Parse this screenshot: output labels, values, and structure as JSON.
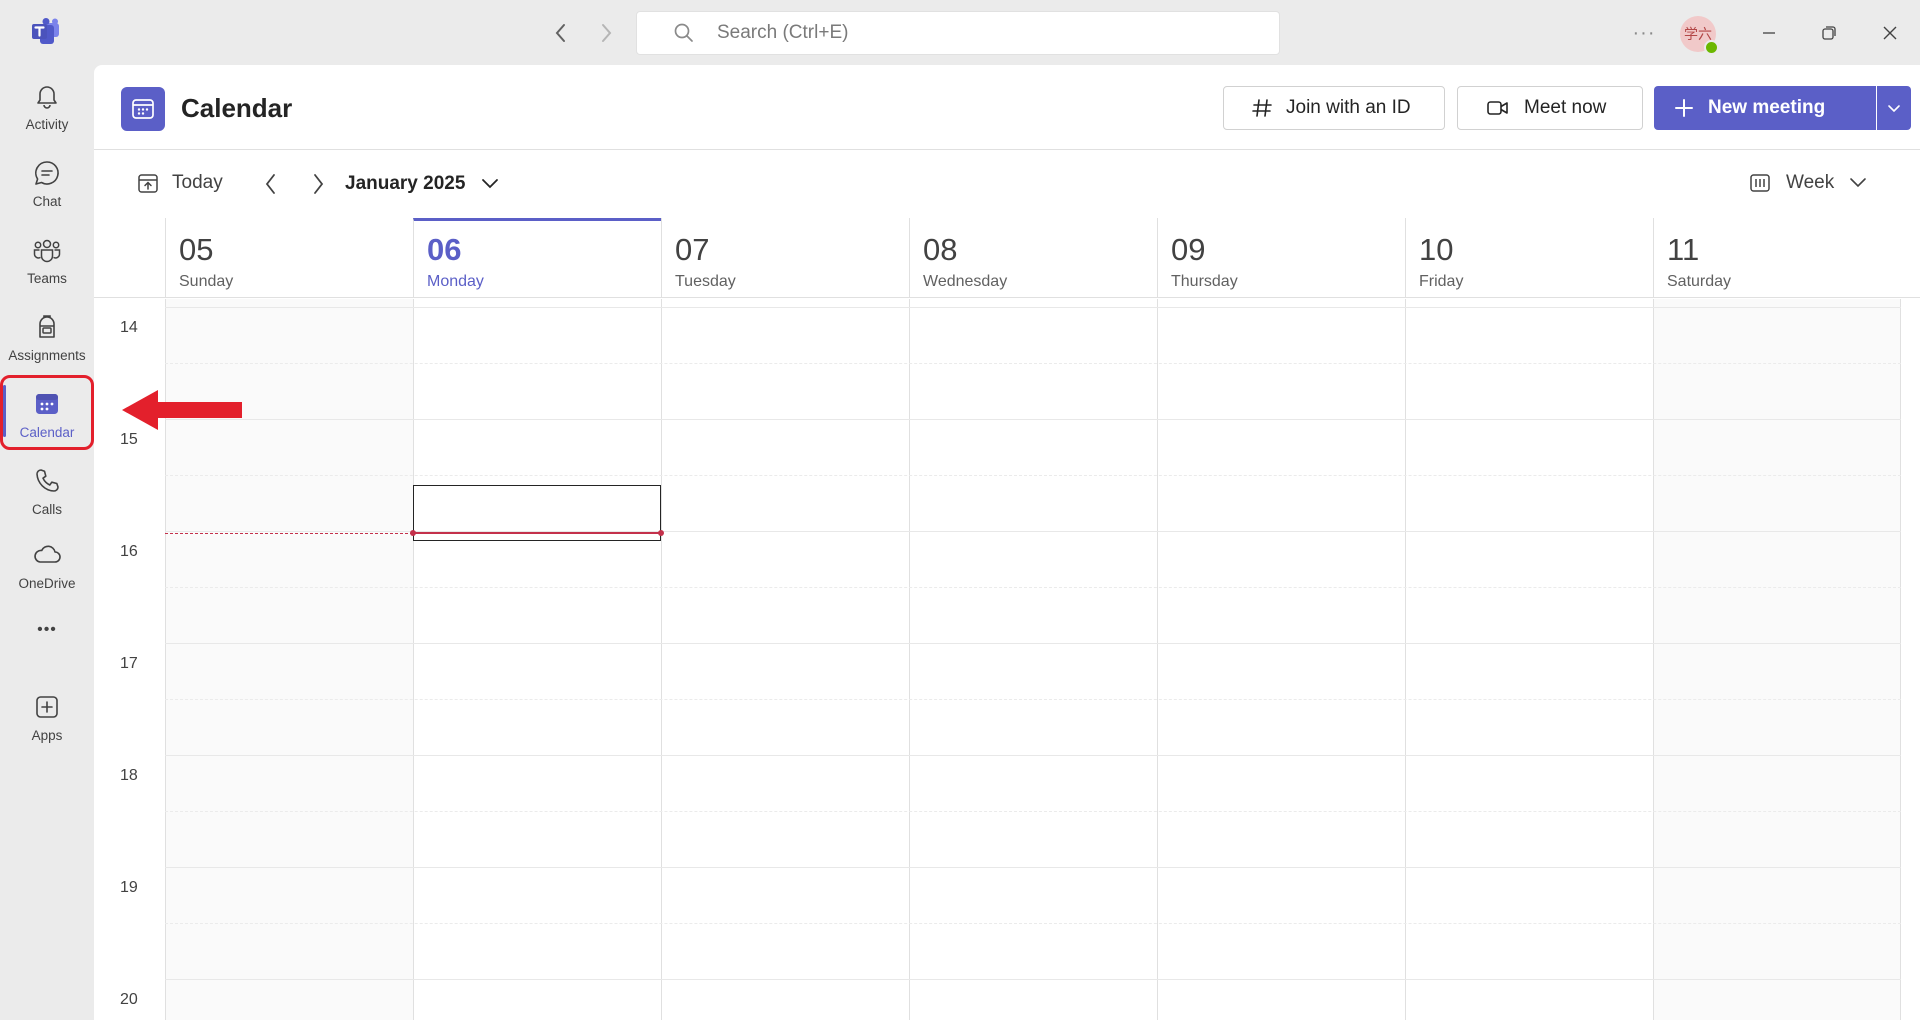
{
  "titlebar": {
    "search_placeholder": "Search (Ctrl+E)",
    "more": "···",
    "avatar_initials": "学六"
  },
  "rail": {
    "items": [
      {
        "label": "Activity",
        "icon": "bell-icon"
      },
      {
        "label": "Chat",
        "icon": "chat-icon"
      },
      {
        "label": "Teams",
        "icon": "teams-icon"
      },
      {
        "label": "Assignments",
        "icon": "backpack-icon"
      },
      {
        "label": "Calendar",
        "icon": "calendar-icon",
        "active": true
      },
      {
        "label": "Calls",
        "icon": "phone-icon"
      },
      {
        "label": "OneDrive",
        "icon": "cloud-icon"
      },
      {
        "label": "Apps",
        "icon": "add-app-icon"
      }
    ],
    "more": "•••"
  },
  "header": {
    "title": "Calendar",
    "join_label": "Join with an ID",
    "meet_label": "Meet now",
    "new_label": "New meeting"
  },
  "toolbar": {
    "today_label": "Today",
    "month_label": "January 2025",
    "view_label": "Week"
  },
  "days": [
    {
      "num": "05",
      "name": "Sunday"
    },
    {
      "num": "06",
      "name": "Monday",
      "today": true
    },
    {
      "num": "07",
      "name": "Tuesday"
    },
    {
      "num": "08",
      "name": "Wednesday"
    },
    {
      "num": "09",
      "name": "Thursday"
    },
    {
      "num": "10",
      "name": "Friday"
    },
    {
      "num": "11",
      "name": "Saturday"
    }
  ],
  "hours": [
    "14",
    "15",
    "16",
    "17",
    "18",
    "19",
    "20"
  ],
  "colors": {
    "accent": "#5b5fc7",
    "now_line": "#c4314b",
    "annotation": "#e3202c"
  }
}
